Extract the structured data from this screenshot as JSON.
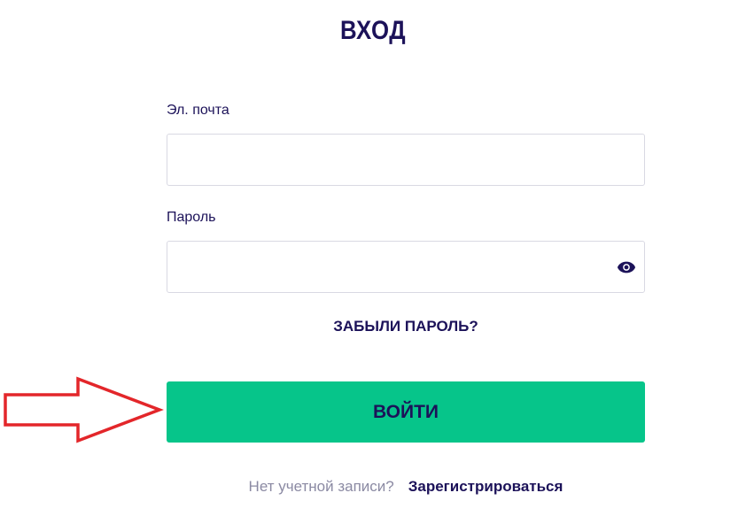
{
  "page": {
    "title": "ВХОД"
  },
  "form": {
    "email": {
      "label": "Эл. почта",
      "value": "",
      "placeholder": ""
    },
    "password": {
      "label": "Пароль",
      "value": "",
      "placeholder": "",
      "toggle_icon": "eye-icon"
    },
    "forgot_password_label": "ЗАБЫЛИ ПАРОЛЬ?",
    "submit_label": "ВОЙТИ"
  },
  "signup": {
    "prompt": "Нет учетной записи?",
    "link_label": "Зарегистрироваться"
  },
  "annotation": {
    "icon": "red-outline-arrow-icon",
    "color": "#e3262a"
  },
  "colors": {
    "primary_text": "#1c1259",
    "accent_button": "#06c58a",
    "muted_text": "#8b8aa3",
    "input_border": "#d9d9e3"
  }
}
